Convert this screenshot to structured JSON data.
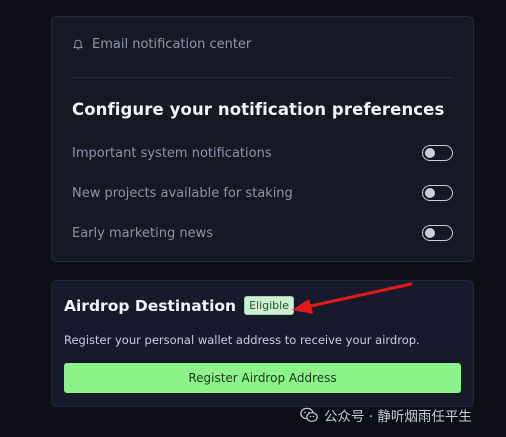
{
  "notifications": {
    "header_label": "Email notification center",
    "title": "Configure your notification preferences",
    "items": [
      {
        "label": "Important system notifications",
        "enabled": false
      },
      {
        "label": "New projects available for staking",
        "enabled": false
      },
      {
        "label": "Early marketing news",
        "enabled": false
      }
    ]
  },
  "airdrop": {
    "title": "Airdrop Destination",
    "badge": "Eligible",
    "description": "Register your personal wallet address to receive your airdrop.",
    "button_label": "Register Airdrop Address"
  },
  "watermark": {
    "text": "公众号 · 静听烟雨任平生"
  },
  "colors": {
    "background": "#0e0f16",
    "card": "#161924",
    "accent_green": "#8ef28a",
    "arrow_red": "#e01b1b"
  },
  "icons": {
    "header": "bell-icon",
    "watermark": "wechat-logo"
  }
}
